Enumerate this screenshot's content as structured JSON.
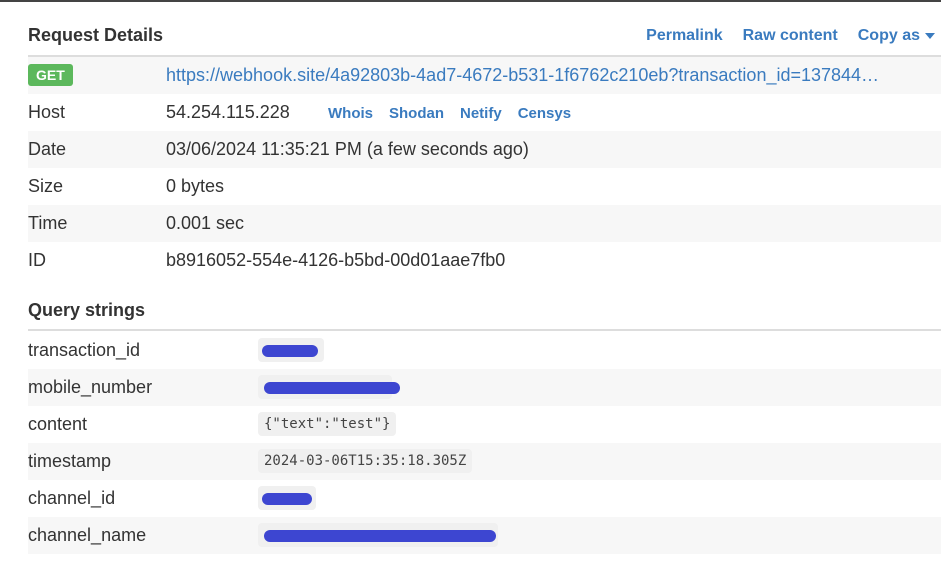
{
  "header": {
    "title": "Request Details",
    "permalink": "Permalink",
    "raw_content": "Raw content",
    "copy_as": "Copy as"
  },
  "request": {
    "method": "GET",
    "url": "https://webhook.site/4a92803b-4ad7-4672-b531-1f6762c210eb?transaction_id=137844…",
    "host_label": "Host",
    "host": "54.254.115.228",
    "host_links": [
      "Whois",
      "Shodan",
      "Netify",
      "Censys"
    ],
    "date_label": "Date",
    "date": "03/06/2024 11:35:21 PM (a few seconds ago)",
    "size_label": "Size",
    "size": "0 bytes",
    "time_label": "Time",
    "time": "0.001 sec",
    "id_label": "ID",
    "id": "b8916052-554e-4126-b5bd-00d01aae7fb0"
  },
  "query": {
    "title": "Query strings",
    "rows": [
      {
        "key": "transaction_id",
        "value": "",
        "redacted": true
      },
      {
        "key": "mobile_number",
        "value": "",
        "redacted": true
      },
      {
        "key": "content",
        "value": "{\"text\":\"test\"}",
        "redacted": false
      },
      {
        "key": "timestamp",
        "value": "2024-03-06T15:35:18.305Z",
        "redacted": false
      },
      {
        "key": "channel_id",
        "value": "",
        "redacted": true
      },
      {
        "key": "channel_name",
        "value": "",
        "redacted": true
      }
    ]
  },
  "colors": {
    "link": "#3a7bbf",
    "badge": "#5cb85c",
    "redaction": "#3d46d1"
  }
}
